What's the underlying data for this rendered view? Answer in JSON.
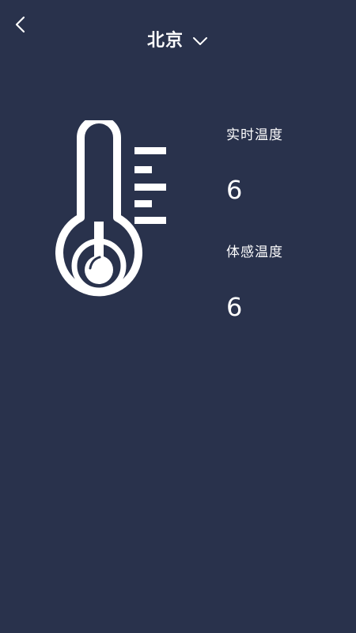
{
  "header": {
    "city": "北京",
    "back_icon": "chevron-left-icon",
    "dropdown_icon": "chevron-down-icon"
  },
  "weather": {
    "realtime_label": "实时温度",
    "realtime_value": "6",
    "feels_like_label": "体感温度",
    "feels_like_value": "6",
    "illustration_icon": "thermometer-icon"
  },
  "colors": {
    "background": "#29324c",
    "foreground": "#ffffff"
  }
}
